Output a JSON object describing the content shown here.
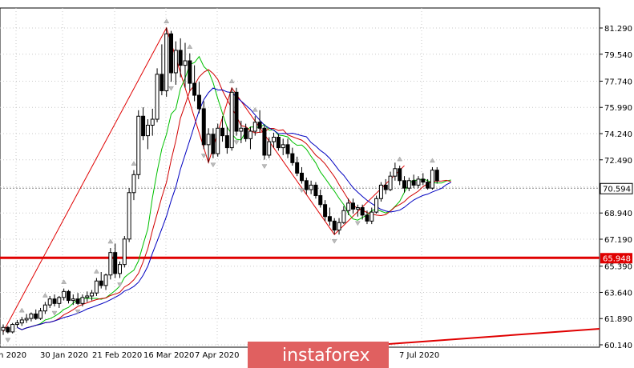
{
  "chart_data": {
    "type": "candlestick",
    "y_ticks": [
      60.14,
      61.89,
      63.64,
      65.39,
      67.19,
      68.94,
      70.69,
      72.49,
      74.24,
      75.99,
      77.74,
      79.54,
      81.29
    ],
    "y_tick_labels": [
      "60.140",
      "61.890",
      "63.640",
      "65.390",
      "67.190",
      "68.940",
      "70.690",
      "72.490",
      "74.240",
      "75.990",
      "77.740",
      "79.540",
      "81.290"
    ],
    "x_tick_labels": [
      "an 2020",
      "30 Jan 2020",
      "21 Feb 2020",
      "16 Mar 2020",
      "7 Apr 2020",
      "7 Jul 2020"
    ],
    "current_price": "70.594",
    "support_level": "65.948",
    "support_value": 65.948,
    "current_value": 70.594,
    "candles": [
      [
        61.1,
        61.5,
        60.8,
        61.3
      ],
      [
        61.3,
        61.4,
        60.9,
        61.0
      ],
      [
        61.0,
        61.6,
        60.9,
        61.5
      ],
      [
        61.5,
        61.8,
        61.3,
        61.6
      ],
      [
        61.6,
        62.0,
        61.4,
        61.8
      ],
      [
        61.8,
        62.2,
        61.6,
        61.9
      ],
      [
        61.9,
        62.3,
        61.7,
        62.2
      ],
      [
        62.2,
        62.5,
        61.8,
        61.9
      ],
      [
        61.9,
        62.6,
        61.8,
        62.4
      ],
      [
        62.4,
        63.0,
        62.2,
        62.8
      ],
      [
        62.8,
        63.4,
        62.6,
        63.2
      ],
      [
        63.2,
        63.5,
        62.7,
        62.9
      ],
      [
        62.9,
        63.4,
        62.6,
        63.3
      ],
      [
        63.3,
        63.9,
        63.1,
        63.7
      ],
      [
        63.7,
        63.8,
        62.9,
        63.1
      ],
      [
        63.1,
        63.5,
        62.8,
        63.2
      ],
      [
        63.2,
        63.6,
        62.8,
        62.9
      ],
      [
        62.9,
        63.5,
        62.7,
        63.3
      ],
      [
        63.3,
        63.7,
        63.0,
        63.4
      ],
      [
        63.4,
        63.8,
        63.1,
        63.6
      ],
      [
        63.6,
        64.6,
        63.4,
        64.4
      ],
      [
        64.4,
        65.0,
        63.9,
        64.1
      ],
      [
        64.1,
        64.9,
        63.8,
        64.8
      ],
      [
        64.8,
        66.6,
        64.5,
        66.3
      ],
      [
        66.3,
        66.9,
        64.6,
        64.9
      ],
      [
        64.9,
        65.7,
        64.6,
        65.5
      ],
      [
        65.5,
        67.4,
        65.3,
        67.2
      ],
      [
        67.2,
        70.6,
        67.0,
        70.3
      ],
      [
        70.3,
        71.8,
        69.8,
        71.5
      ],
      [
        71.5,
        75.8,
        71.2,
        75.4
      ],
      [
        75.4,
        76.0,
        73.8,
        74.1
      ],
      [
        74.1,
        75.2,
        73.2,
        74.8
      ],
      [
        74.8,
        75.9,
        74.1,
        75.2
      ],
      [
        75.2,
        78.6,
        75.0,
        78.2
      ],
      [
        78.2,
        80.2,
        76.8,
        77.1
      ],
      [
        77.1,
        81.3,
        76.7,
        80.9
      ],
      [
        80.9,
        81.1,
        77.7,
        78.3
      ],
      [
        78.3,
        80.4,
        77.5,
        79.8
      ],
      [
        79.8,
        80.6,
        78.0,
        78.8
      ],
      [
        78.8,
        80.3,
        77.3,
        79.1
      ],
      [
        79.1,
        79.6,
        77.1,
        77.6
      ],
      [
        77.6,
        78.8,
        76.4,
        76.8
      ],
      [
        76.8,
        77.7,
        75.6,
        75.9
      ],
      [
        75.9,
        76.4,
        73.2,
        73.5
      ],
      [
        73.5,
        74.6,
        72.3,
        74.2
      ],
      [
        74.2,
        74.6,
        72.6,
        72.9
      ],
      [
        72.9,
        74.9,
        72.7,
        74.6
      ],
      [
        74.6,
        75.4,
        73.7,
        74.1
      ],
      [
        74.1,
        74.7,
        72.9,
        73.3
      ],
      [
        73.3,
        77.3,
        73.1,
        77.0
      ],
      [
        77.0,
        77.3,
        74.1,
        74.4
      ],
      [
        74.4,
        75.1,
        73.6,
        74.6
      ],
      [
        74.6,
        74.9,
        73.7,
        73.9
      ],
      [
        73.9,
        74.7,
        73.2,
        74.4
      ],
      [
        74.4,
        75.4,
        74.1,
        75.0
      ],
      [
        75.0,
        75.8,
        74.3,
        74.6
      ],
      [
        74.6,
        74.8,
        72.5,
        72.8
      ],
      [
        72.8,
        74.0,
        72.6,
        73.7
      ],
      [
        73.7,
        74.3,
        73.3,
        74.0
      ],
      [
        74.0,
        74.2,
        73.1,
        73.3
      ],
      [
        73.3,
        73.9,
        72.8,
        73.5
      ],
      [
        73.5,
        73.9,
        72.6,
        72.9
      ],
      [
        72.9,
        73.3,
        72.1,
        72.3
      ],
      [
        72.3,
        72.7,
        71.4,
        71.6
      ],
      [
        71.6,
        72.0,
        70.9,
        71.1
      ],
      [
        71.1,
        71.3,
        70.2,
        70.5
      ],
      [
        70.5,
        71.1,
        70.2,
        70.8
      ],
      [
        70.8,
        71.0,
        69.9,
        70.1
      ],
      [
        70.1,
        70.5,
        69.3,
        69.5
      ],
      [
        69.5,
        69.8,
        68.4,
        68.7
      ],
      [
        68.7,
        69.3,
        68.1,
        68.4
      ],
      [
        68.4,
        68.6,
        67.5,
        67.8
      ],
      [
        67.8,
        68.6,
        67.5,
        68.3
      ],
      [
        68.3,
        69.4,
        68.2,
        69.1
      ],
      [
        69.1,
        69.9,
        68.8,
        69.6
      ],
      [
        69.6,
        69.9,
        68.9,
        69.2
      ],
      [
        69.2,
        69.5,
        68.7,
        69.3
      ],
      [
        69.3,
        69.5,
        68.5,
        68.8
      ],
      [
        68.8,
        69.1,
        68.2,
        68.4
      ],
      [
        68.4,
        69.3,
        68.2,
        69.0
      ],
      [
        69.0,
        70.1,
        68.9,
        69.9
      ],
      [
        69.9,
        71.0,
        69.7,
        70.8
      ],
      [
        70.8,
        71.2,
        70.2,
        70.5
      ],
      [
        70.5,
        71.7,
        70.4,
        71.4
      ],
      [
        71.4,
        72.3,
        71.1,
        71.9
      ],
      [
        71.9,
        72.1,
        70.8,
        71.1
      ],
      [
        71.1,
        71.4,
        70.3,
        70.6
      ],
      [
        70.6,
        71.3,
        70.4,
        71.1
      ],
      [
        71.1,
        71.5,
        70.6,
        70.8
      ],
      [
        70.8,
        71.4,
        70.6,
        71.2
      ],
      [
        71.2,
        71.6,
        70.8,
        71.0
      ],
      [
        71.0,
        71.2,
        70.5,
        70.6
      ],
      [
        70.6,
        72.0,
        70.5,
        71.8
      ],
      [
        71.8,
        72.0,
        70.9,
        71.1
      ]
    ],
    "ma_fast_label": "",
    "ma_mid_label": "",
    "ma_slow_label": ""
  },
  "colors": {
    "bull": "#ffffff",
    "bear": "#000000",
    "grid": "#c8c8c8",
    "ma_fast": "#00c000",
    "ma_mid": "#d00000",
    "ma_slow": "#0000c0",
    "support_line": "#e00000",
    "trend_line": "#e00000",
    "price_box_bg": "#ffffff",
    "support_box_bg": "#e00000",
    "watermark_bg": "#e06060"
  },
  "watermark": "instaforex"
}
